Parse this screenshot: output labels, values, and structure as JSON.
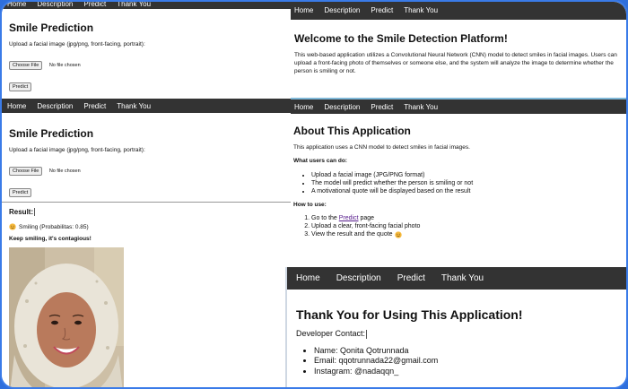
{
  "nav": {
    "home": "Home",
    "description": "Description",
    "predict": "Predict",
    "thank_you": "Thank You"
  },
  "predict_page": {
    "title": "Smile Prediction",
    "upload_label": "Upload a facial image (jpg/png, front-facing, portrait):",
    "choose_file": "Choose File",
    "no_file": "No file chosen",
    "predict_button": "Predict"
  },
  "result": {
    "heading": "Result:",
    "line": "Smiling (Probabilitas: 0.85)",
    "message": "Keep smiling, it's contagious!"
  },
  "welcome": {
    "title": "Welcome to the Smile Detection Platform!",
    "body": "This web-based application utilizes a Convolutional Neural Network (CNN) model to detect smiles in facial images. Users can upload a front-facing photo of themselves or someone else, and the system will analyze the image to determine whether the person is smiling or not."
  },
  "about": {
    "title": "About This Application",
    "intro": "This application uses a CNN model to detect smiles in facial images.",
    "can_do_heading": "What users can do:",
    "can_do_items": [
      "Upload a facial image (JPG/PNG format)",
      "The model will predict whether the person is smiling or not",
      "A motivational quote will be displayed based on the result"
    ],
    "how_heading": "How to use:",
    "how_step1_prefix": "Go to the",
    "how_step1_link": "Predict",
    "how_step1_suffix": "page",
    "how_step2": "Upload a clear, front-facing facial photo",
    "how_step3": "View the result and the quote"
  },
  "thanks": {
    "title": "Thank You for Using This Application!",
    "contact_heading": "Developer Contact:",
    "contacts": [
      "Name: Qonita Qotrunnada",
      "Email: qqotrunnada22@gmail.com",
      "Instagram: @nadaqqn_"
    ]
  },
  "colors": {
    "nav_bg": "#333333",
    "frame_border": "#3a7be8",
    "link": "#551a8b"
  }
}
